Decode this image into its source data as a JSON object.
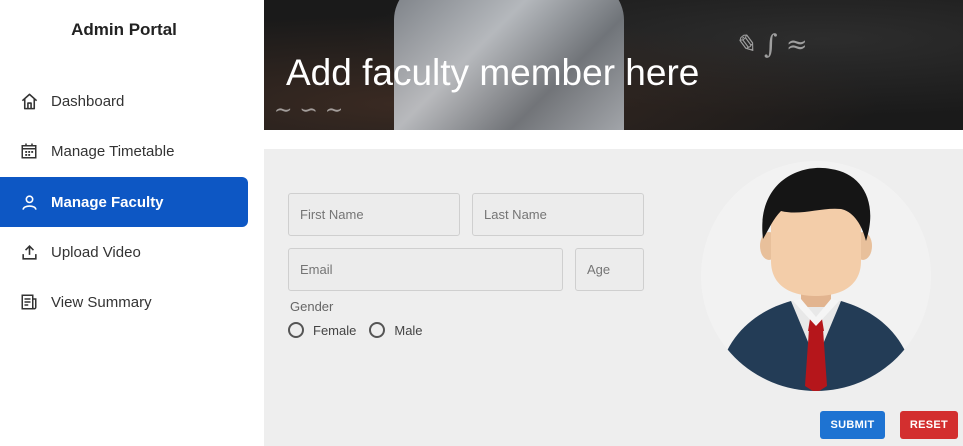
{
  "sidebar": {
    "brand": "Admin Portal",
    "items": [
      {
        "label": "Dashboard",
        "icon": "home-icon",
        "active": false
      },
      {
        "label": "Manage Timetable",
        "icon": "calendar-icon",
        "active": false
      },
      {
        "label": "Manage Faculty",
        "icon": "person-icon",
        "active": true
      },
      {
        "label": "Upload Video",
        "icon": "upload-icon",
        "active": false
      },
      {
        "label": "View Summary",
        "icon": "document-icon",
        "active": false
      }
    ]
  },
  "banner": {
    "title": "Add faculty member here"
  },
  "form": {
    "first_name": {
      "placeholder": "First Name",
      "value": ""
    },
    "last_name": {
      "placeholder": "Last Name",
      "value": ""
    },
    "email": {
      "placeholder": "Email",
      "value": ""
    },
    "age": {
      "placeholder": "Age",
      "value": ""
    },
    "gender": {
      "label": "Gender",
      "options": [
        "Female",
        "Male"
      ],
      "selected": null
    },
    "submit_label": "SUBMIT",
    "reset_label": "RESET"
  },
  "colors": {
    "active_nav": "#0d57c4",
    "submit": "#1e73d2",
    "reset": "#d32f2f",
    "form_background": "#eeeeee"
  }
}
